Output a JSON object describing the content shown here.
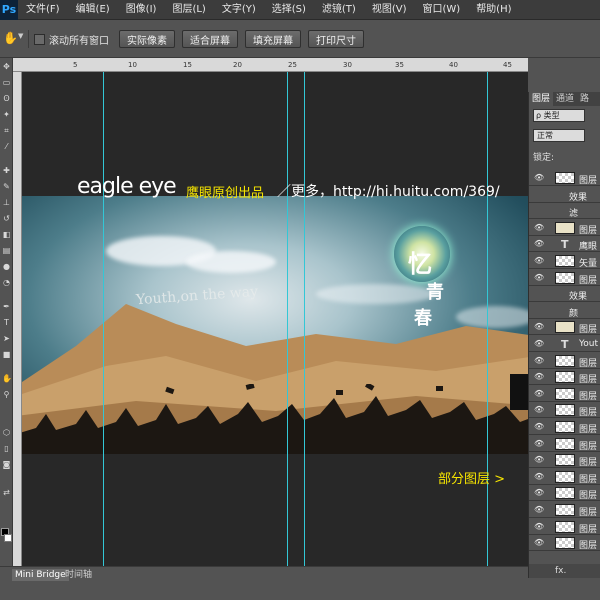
{
  "menubar": {
    "logo": "Ps",
    "items": [
      "文件(F)",
      "编辑(E)",
      "图像(I)",
      "图层(L)",
      "文字(Y)",
      "选择(S)",
      "滤镜(T)",
      "视图(V)",
      "窗口(W)",
      "帮助(H)"
    ]
  },
  "options": {
    "scroll_all_label": "滚动所有窗口",
    "buttons": [
      "实际像素",
      "适合屏幕",
      "填充屏幕",
      "打印尺寸"
    ]
  },
  "ruler": {
    "ticks": [
      "5",
      "10",
      "15",
      "20",
      "25",
      "30",
      "35",
      "40",
      "45",
      "50"
    ]
  },
  "artwork": {
    "brand": "eagle eye",
    "credit": "鹰眼原创出品",
    "more": "／更多，http://hi.huitu.com/369/",
    "partial_layers": "部分图层  >",
    "youth_text": "Youth,on the way",
    "title_chars": [
      "忆",
      "青",
      "春"
    ]
  },
  "bottom_tabs": [
    "Mini Bridge",
    "时间轴"
  ],
  "layers_panel": {
    "tabs": [
      "图层",
      "通道",
      "路"
    ],
    "filter": "ρ 类型",
    "blend": "正常",
    "lock_label": "锁定:",
    "layers": [
      {
        "name": "图层",
        "type": "pixel"
      },
      {
        "name": "效果",
        "type": "effect"
      },
      {
        "name": "滤",
        "type": "effect"
      },
      {
        "name": "图层",
        "type": "beige"
      },
      {
        "name": "鹰眼",
        "type": "text"
      },
      {
        "name": "矢量",
        "type": "pixel"
      },
      {
        "name": "图层",
        "type": "pixel"
      },
      {
        "name": "效果",
        "type": "effect"
      },
      {
        "name": "颜",
        "type": "effect"
      },
      {
        "name": "图层",
        "type": "beige"
      },
      {
        "name": "Yout",
        "type": "text"
      },
      {
        "name": "图层",
        "type": "pixel"
      },
      {
        "name": "图层",
        "type": "pixel"
      },
      {
        "name": "图层",
        "type": "pixel"
      },
      {
        "name": "图层",
        "type": "pixel"
      },
      {
        "name": "图层",
        "type": "pixel"
      },
      {
        "name": "图层",
        "type": "pixel"
      },
      {
        "name": "图层",
        "type": "pixel"
      },
      {
        "name": "图层",
        "type": "pixel"
      },
      {
        "name": "图层",
        "type": "pixel"
      },
      {
        "name": "图层",
        "type": "pixel"
      },
      {
        "name": "图层",
        "type": "pixel"
      },
      {
        "name": "图层",
        "type": "pixel"
      }
    ],
    "footer": "fx."
  }
}
